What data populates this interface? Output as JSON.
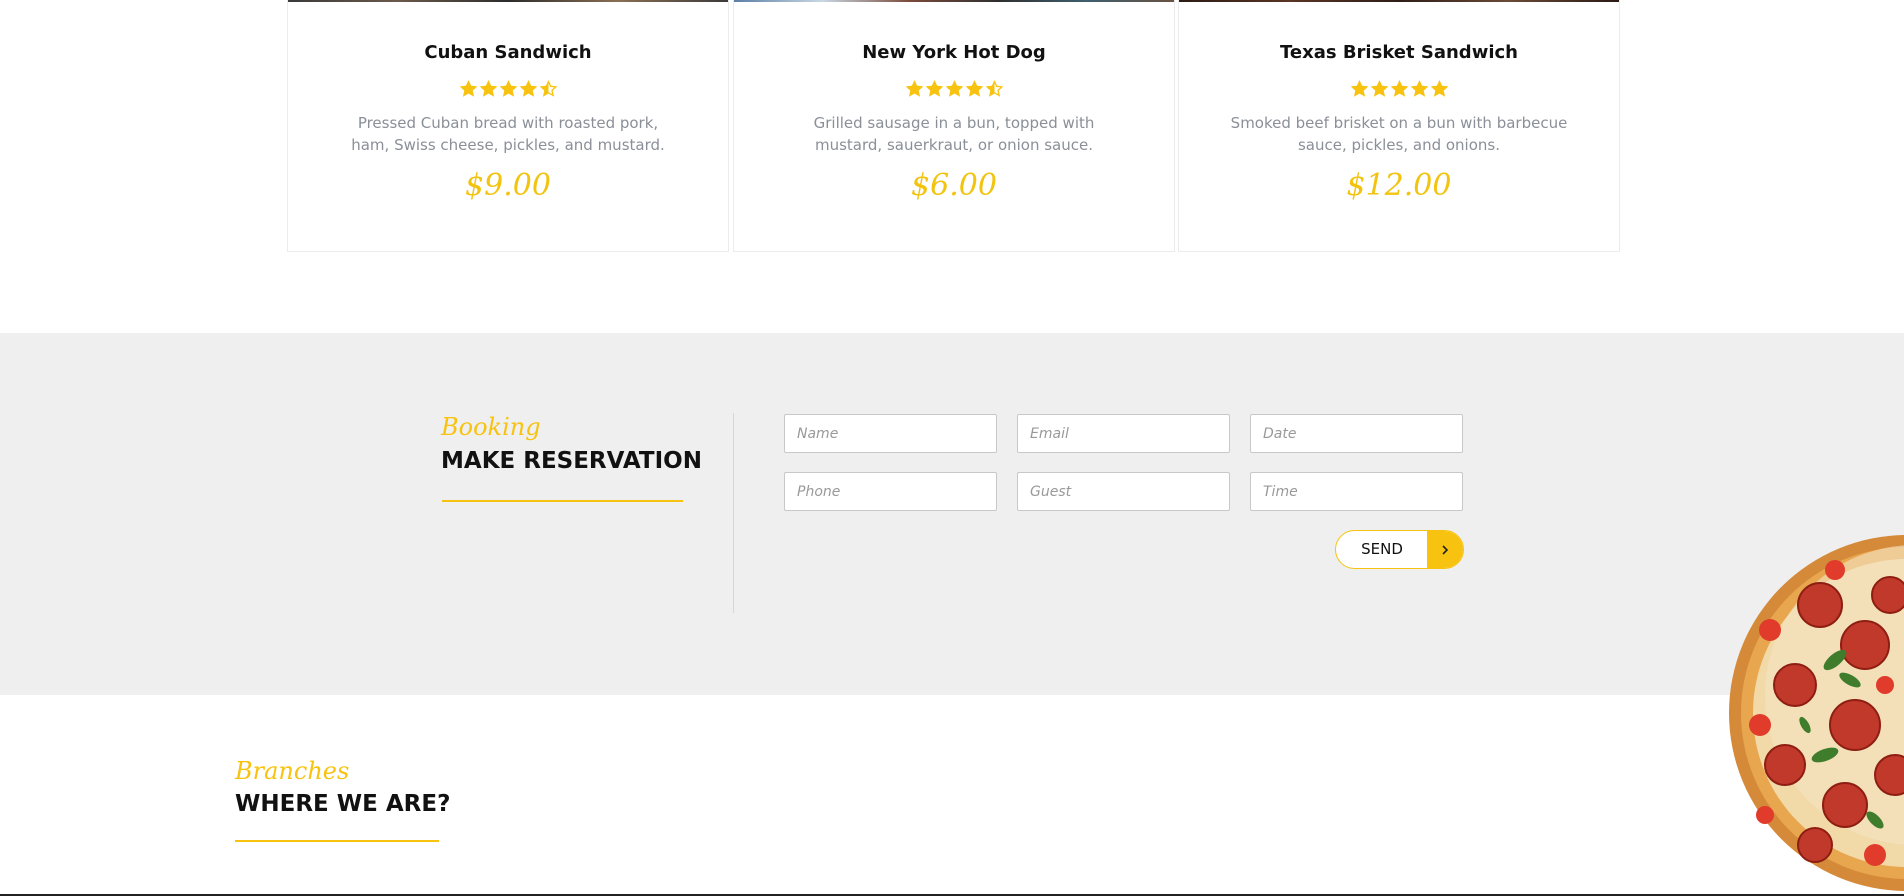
{
  "menu": {
    "items": [
      {
        "title": "Cuban Sandwich",
        "rating": 4.5,
        "description": "Pressed Cuban bread with roasted pork, ham, Swiss cheese, pickles, and mustard.",
        "price": "$9.00"
      },
      {
        "title": "New York Hot Dog",
        "rating": 4.5,
        "description": "Grilled sausage in a bun, topped with mustard, sauerkraut, or onion sauce.",
        "price": "$6.00"
      },
      {
        "title": "Texas Brisket Sandwich",
        "rating": 5,
        "description": "Smoked beef brisket on a bun with barbecue sauce, pickles, and onions.",
        "price": "$12.00"
      }
    ]
  },
  "booking": {
    "subtitle": "Booking",
    "title": "MAKE RESERVATION",
    "fields": {
      "name": "Name",
      "email": "Email",
      "date": "Date",
      "phone": "Phone",
      "guest": "Guest",
      "time": "Time"
    },
    "send_label": "SEND"
  },
  "branches": {
    "subtitle": "Branches",
    "title": "WHERE WE ARE?"
  },
  "colors": {
    "accent": "#f7c310",
    "price": "#f2c40f",
    "booking_bg": "#efefef",
    "description": "#8a8f98"
  }
}
